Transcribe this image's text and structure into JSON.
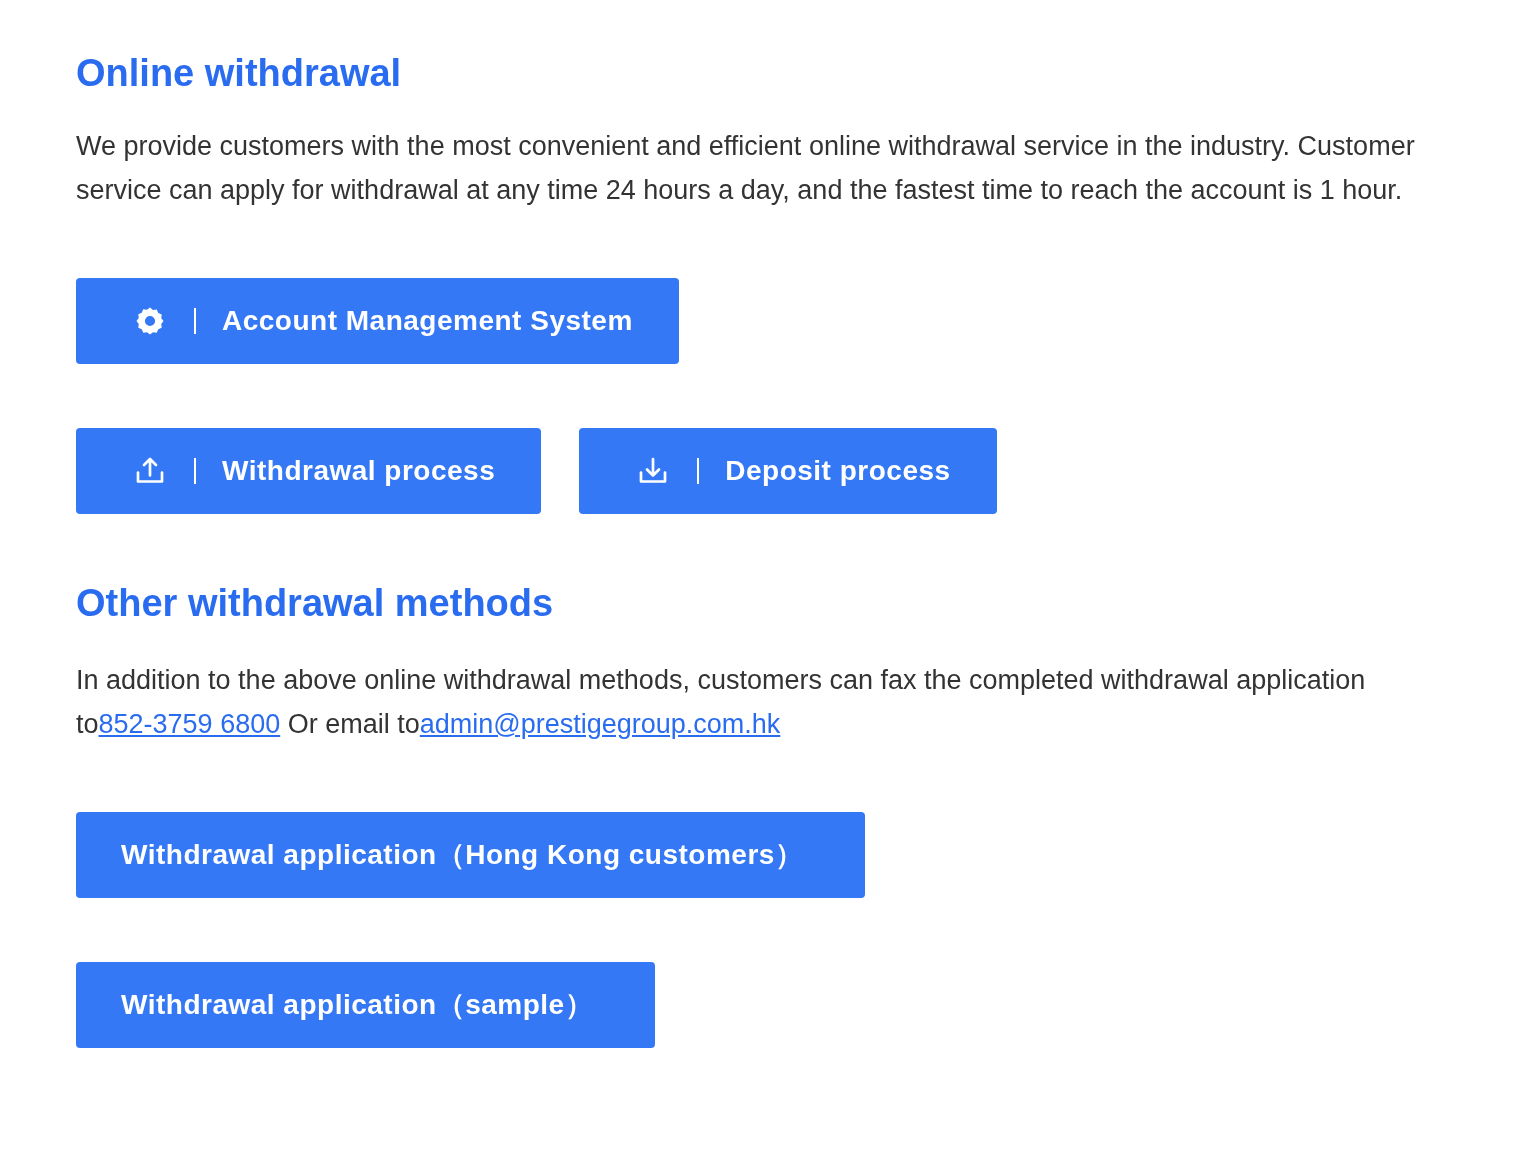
{
  "online": {
    "title": "Online withdrawal",
    "text": "We provide customers with the most convenient and efficient online withdrawal service in the industry. Customer service can apply for withdrawal at any time 24 hours a day, and the fastest time to reach the account is 1 hour.",
    "button_rows": [
      [
        {
          "kind": "settings",
          "label": "Account Management System"
        }
      ],
      [
        {
          "kind": "upload",
          "label": "Withdrawal process"
        },
        {
          "kind": "download",
          "label": "Deposit process"
        }
      ]
    ]
  },
  "other": {
    "title": "Other withdrawal methods",
    "text_before": "In addition to the above online withdrawal methods, customers can fax the completed withdrawal application to",
    "phone": "852-3759 6800",
    "text_middle": " Or email to",
    "email": "admin@prestigegroup.com.hk",
    "buttons": [
      {
        "kind": "plain",
        "label": "Withdrawal application（Hong Kong customers）"
      },
      {
        "kind": "plain",
        "label": "Withdrawal application（sample）"
      }
    ]
  }
}
